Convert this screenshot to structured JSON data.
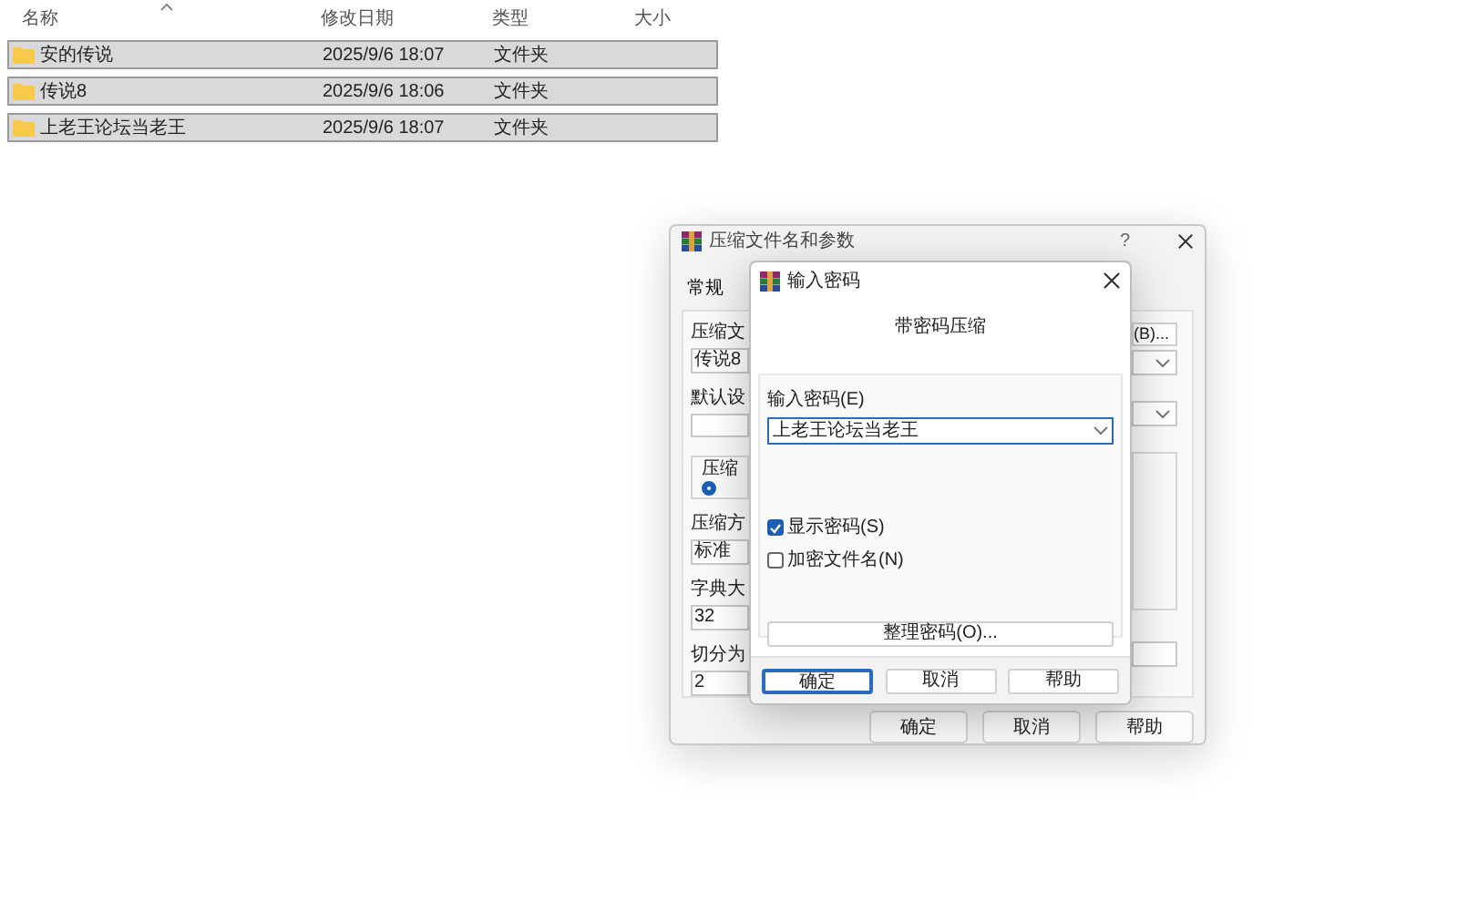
{
  "file_list": {
    "columns": [
      "名称",
      "修改日期",
      "类型",
      "大小"
    ],
    "rows": [
      {
        "name": "安的传说",
        "modified": "2025/9/6 18:07",
        "type": "文件夹",
        "selected": true
      },
      {
        "name": "传说8",
        "modified": "2025/9/6 18:06",
        "type": "文件夹",
        "selected": true
      },
      {
        "name": "上老王论坛当老王",
        "modified": "2025/9/6 18:07",
        "type": "文件夹",
        "selected": true
      }
    ]
  },
  "archive_dialog": {
    "title": "压缩文件名和参数",
    "help": "?",
    "tabs": [
      {
        "label": "常规",
        "selected": true
      }
    ],
    "left_items": [
      {
        "kind": "label",
        "text": "压缩文"
      },
      {
        "kind": "field",
        "value": "传说8"
      },
      {
        "kind": "label",
        "text": "默认设"
      },
      {
        "kind": "field"
      },
      {
        "kind": "group",
        "text": "压缩",
        "selected": true
      },
      {
        "kind": "label",
        "text": "压缩方"
      },
      {
        "kind": "field",
        "value": "标准"
      },
      {
        "kind": "label",
        "text": "字典大"
      },
      {
        "kind": "field",
        "value": "32"
      },
      {
        "kind": "label",
        "text": "切分为"
      },
      {
        "kind": "field",
        "value": "2"
      }
    ],
    "right_items": [
      {
        "kind": "button",
        "text": "(B)..."
      },
      {
        "kind": "dropdown"
      },
      {
        "kind": "dropdown"
      },
      {
        "kind": "group"
      },
      {
        "kind": "field"
      }
    ],
    "buttons": [
      "确定",
      "取消",
      "帮助"
    ]
  },
  "password_dialog": {
    "title": "输入密码",
    "heading": "带密码压缩",
    "password_label": "输入密码(E)",
    "password_value": "上老王论坛当老王",
    "options": [
      {
        "label": "显示密码(S)",
        "checked": true
      },
      {
        "label": "加密文件名(N)",
        "checked": false
      }
    ],
    "organize_button": "整理密码(O)...",
    "buttons": [
      {
        "label": "确定",
        "default": true
      },
      {
        "label": "取消",
        "default": false
      },
      {
        "label": "帮助",
        "default": false
      }
    ]
  }
}
